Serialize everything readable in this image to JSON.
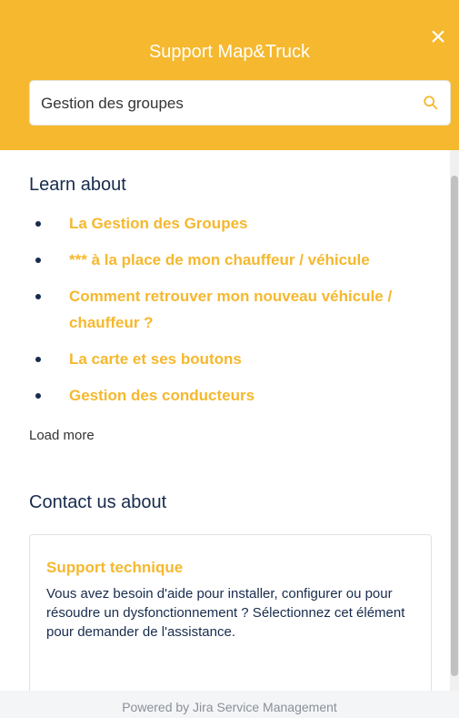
{
  "header": {
    "title": "Support Map&Truck",
    "close_label": "×"
  },
  "search": {
    "value": "Gestion des groupes",
    "icon": "search-icon"
  },
  "learn": {
    "title": "Learn about",
    "articles": [
      {
        "label": "La Gestion des Groupes"
      },
      {
        "label": "*** à la place de mon chauffeur / véhicule"
      },
      {
        "label": "Comment retrouver mon nouveau véhicule / chauffeur ?"
      },
      {
        "label": "La carte et ses boutons"
      },
      {
        "label": "Gestion des conducteurs"
      }
    ],
    "load_more": "Load more"
  },
  "contact": {
    "title": "Contact us about",
    "card": {
      "title": "Support technique",
      "description": "Vous avez besoin d'aide pour installer, configurer ou pour résoudre un dysfonctionnement ? Sélectionnez cet élément pour demander de l'assistance."
    }
  },
  "footer": {
    "text": "Powered by Jira Service Management"
  },
  "colors": {
    "accent": "#f5b82e",
    "text": "#172b4d"
  }
}
